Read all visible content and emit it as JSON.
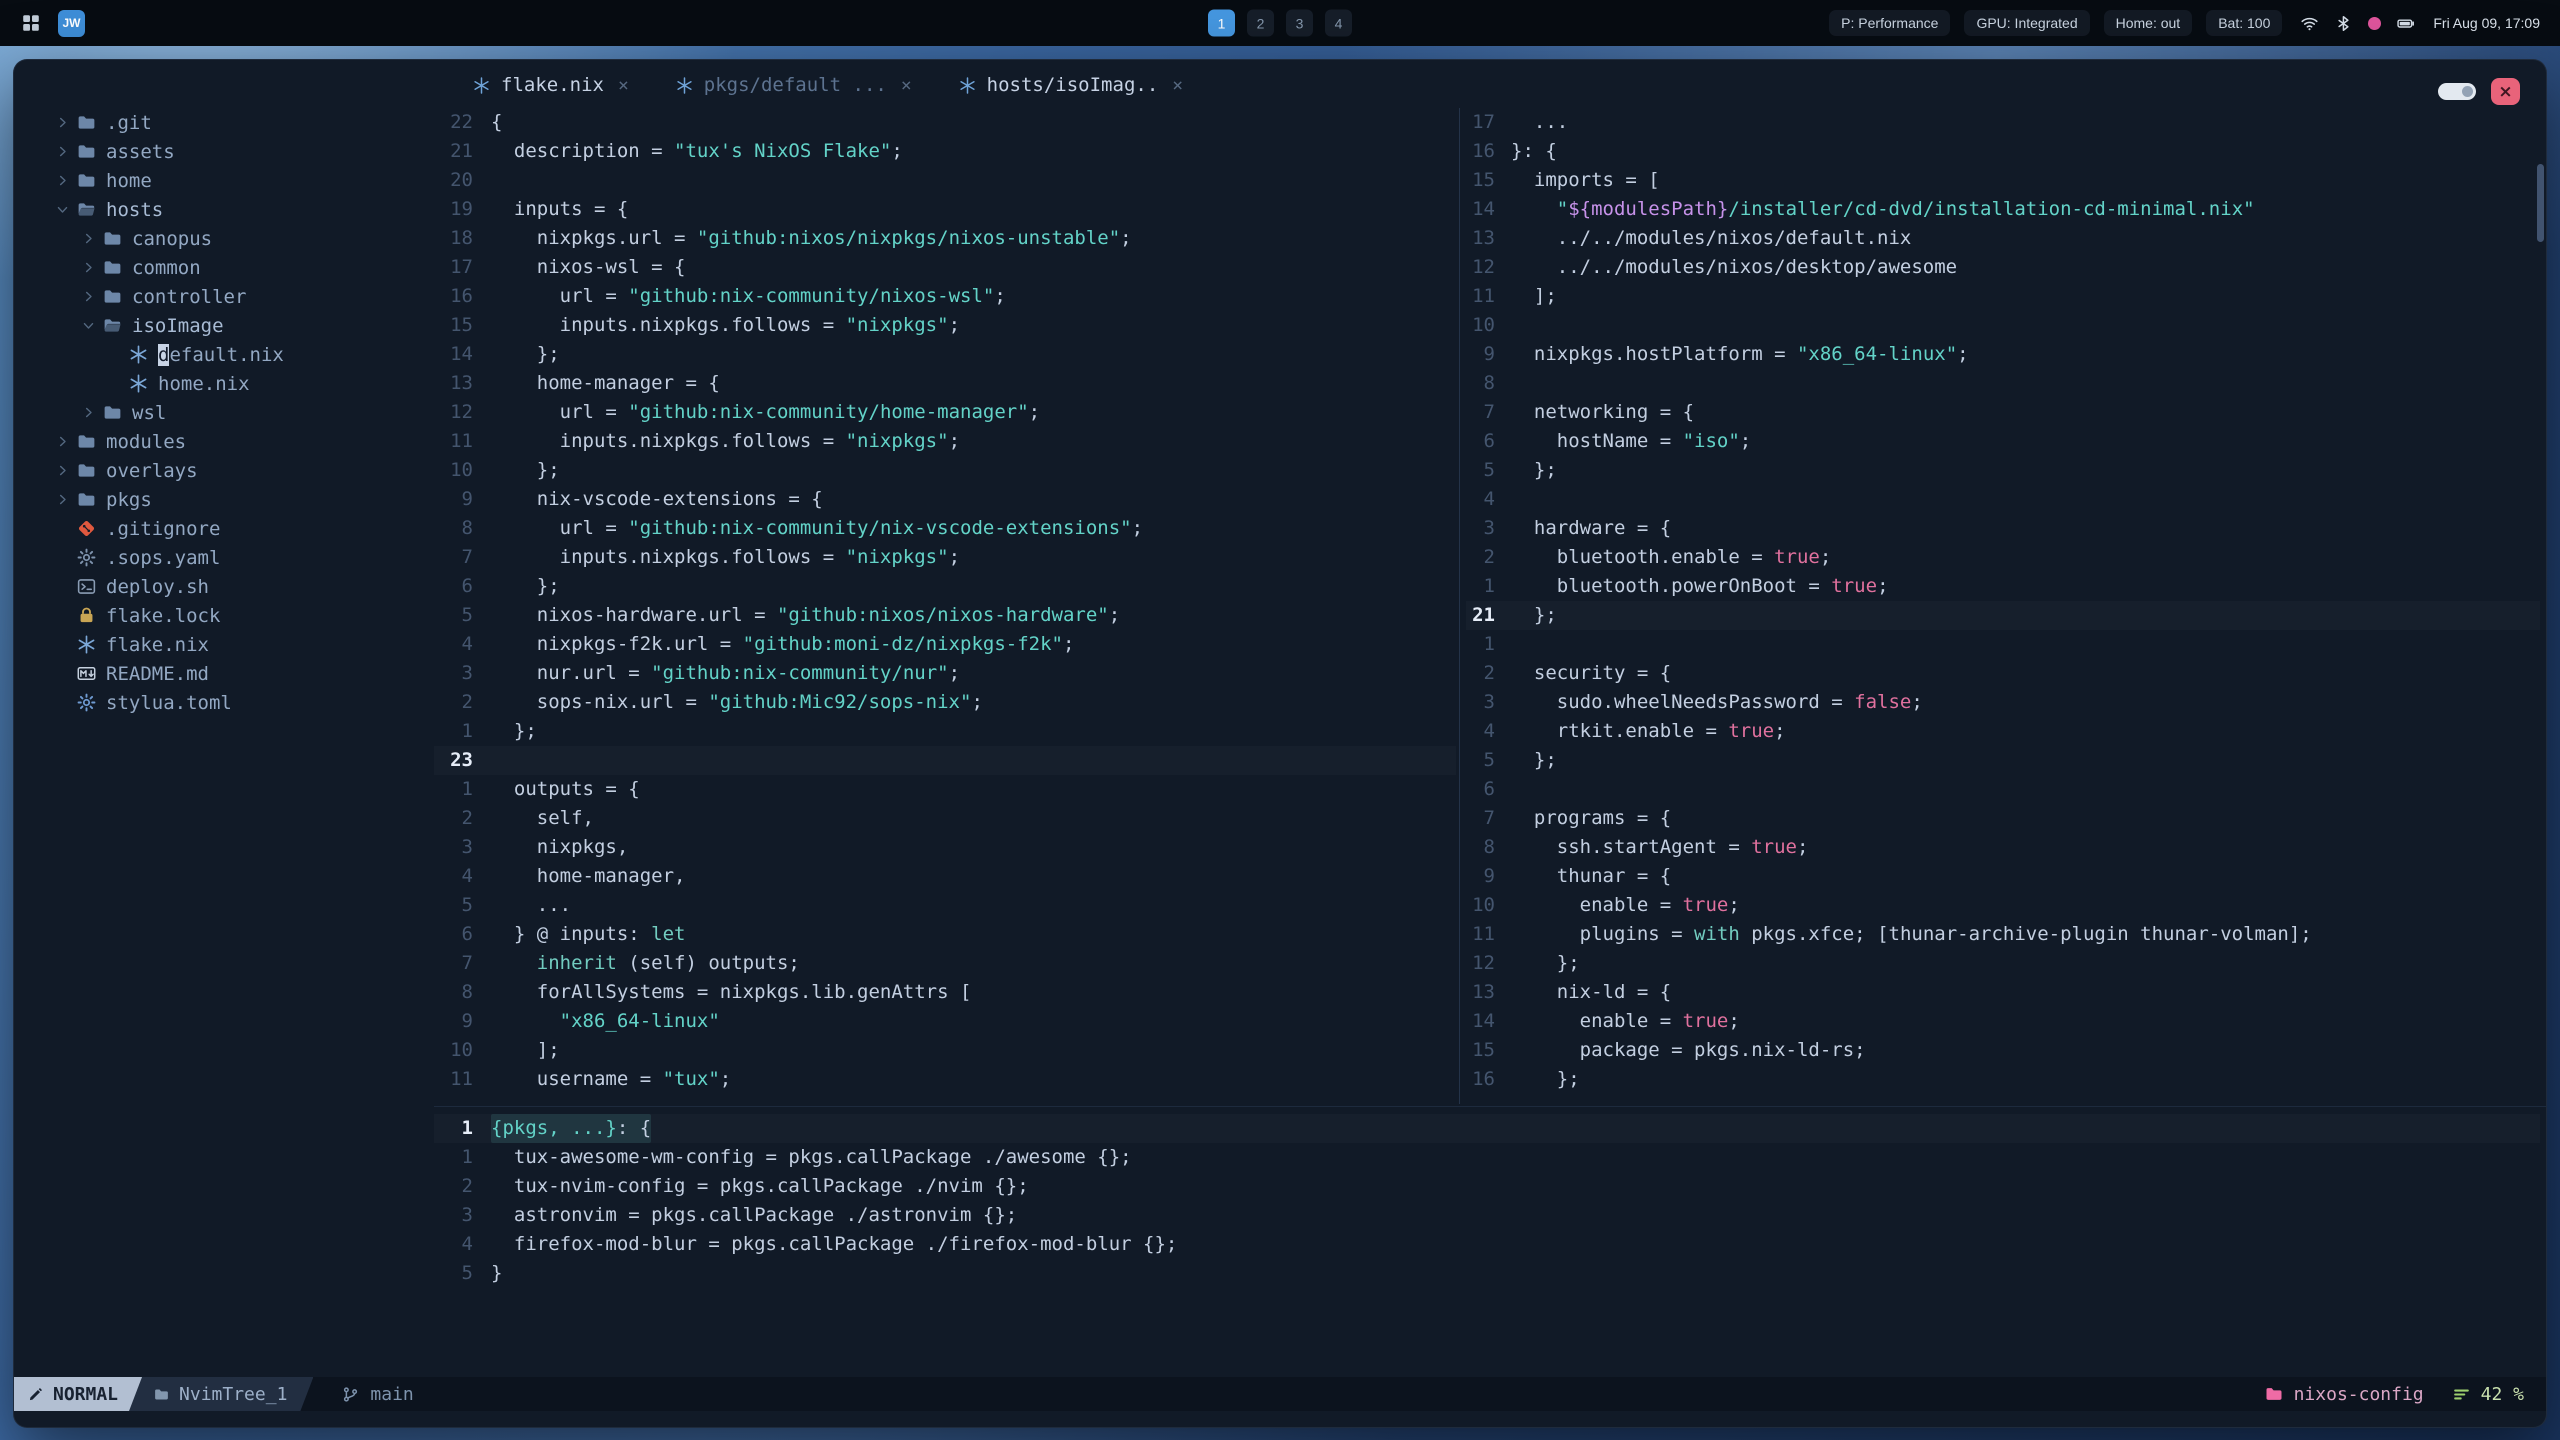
{
  "topbar": {
    "wm_label": "JW",
    "workspaces": [
      "1",
      "2",
      "3",
      "4"
    ],
    "active_workspace": "1",
    "modules": [
      "P: Performance",
      "GPU: Integrated",
      "Home: out",
      "Bat: 100"
    ],
    "clock": "Fri Aug 09, 17:09"
  },
  "window": {
    "tabs": [
      {
        "label": "flake.nix",
        "icon": "nix",
        "visible": true
      },
      {
        "label": "pkgs/default ...",
        "icon": "nix",
        "visible": false
      },
      {
        "label": "hosts/isoImag..",
        "icon": "nix",
        "visible": true
      }
    ],
    "close_label": "×"
  },
  "tree": {
    "items": [
      {
        "indent": 0,
        "chevron": "right",
        "icon": "folder",
        "label": ".git"
      },
      {
        "indent": 0,
        "chevron": "right",
        "icon": "folder",
        "label": "assets"
      },
      {
        "indent": 0,
        "chevron": "right",
        "icon": "folder",
        "label": "home"
      },
      {
        "indent": 0,
        "chevron": "down",
        "icon": "folder-open",
        "label": "hosts",
        "open": true
      },
      {
        "indent": 1,
        "chevron": "right",
        "icon": "folder",
        "label": "canopus"
      },
      {
        "indent": 1,
        "chevron": "right",
        "icon": "folder",
        "label": "common"
      },
      {
        "indent": 1,
        "chevron": "right",
        "icon": "folder",
        "label": "controller"
      },
      {
        "indent": 1,
        "chevron": "down",
        "icon": "folder-open",
        "label": "isoImage",
        "open": true
      },
      {
        "indent": 2,
        "icon": "nix",
        "label": "default.nix",
        "cursor": true
      },
      {
        "indent": 2,
        "icon": "nix",
        "label": "home.nix"
      },
      {
        "indent": 1,
        "chevron": "right",
        "icon": "folder",
        "label": "wsl"
      },
      {
        "indent": 0,
        "chevron": "right",
        "icon": "folder",
        "label": "modules"
      },
      {
        "indent": 0,
        "chevron": "right",
        "icon": "folder",
        "label": "overlays"
      },
      {
        "indent": 0,
        "chevron": "right",
        "icon": "folder",
        "label": "pkgs"
      },
      {
        "indent": 0,
        "icon": "git",
        "label": ".gitignore"
      },
      {
        "indent": 0,
        "icon": "gear",
        "label": ".sops.yaml"
      },
      {
        "indent": 0,
        "icon": "terminal",
        "label": "deploy.sh"
      },
      {
        "indent": 0,
        "icon": "lock",
        "label": "flake.lock"
      },
      {
        "indent": 0,
        "icon": "nix",
        "label": "flake.nix"
      },
      {
        "indent": 0,
        "icon": "markdown",
        "label": "README.md"
      },
      {
        "indent": 0,
        "icon": "gear-blue",
        "label": "stylua.toml"
      }
    ]
  },
  "editors": {
    "flake": [
      {
        "n": "22",
        "t": "{"
      },
      {
        "n": "21",
        "t": "  description = \"tux's NixOS Flake\";"
      },
      {
        "n": "20",
        "t": ""
      },
      {
        "n": "19",
        "t": "  inputs = {"
      },
      {
        "n": "18",
        "t": "    nixpkgs.url = \"github:nixos/nixpkgs/nixos-unstable\";"
      },
      {
        "n": "17",
        "t": "    nixos-wsl = {"
      },
      {
        "n": "16",
        "t": "      url = \"github:nix-community/nixos-wsl\";"
      },
      {
        "n": "15",
        "t": "      inputs.nixpkgs.follows = \"nixpkgs\";"
      },
      {
        "n": "14",
        "t": "    };"
      },
      {
        "n": "13",
        "t": "    home-manager = {"
      },
      {
        "n": "12",
        "t": "      url = \"github:nix-community/home-manager\";"
      },
      {
        "n": "11",
        "t": "      inputs.nixpkgs.follows = \"nixpkgs\";"
      },
      {
        "n": "10",
        "t": "    };"
      },
      {
        "n": "9",
        "t": "    nix-vscode-extensions = {"
      },
      {
        "n": "8",
        "t": "      url = \"github:nix-community/nix-vscode-extensions\";"
      },
      {
        "n": "7",
        "t": "      inputs.nixpkgs.follows = \"nixpkgs\";"
      },
      {
        "n": "6",
        "t": "    };"
      },
      {
        "n": "5",
        "t": "    nixos-hardware.url = \"github:nixos/nixos-hardware\";"
      },
      {
        "n": "4",
        "t": "    nixpkgs-f2k.url = \"github:moni-dz/nixpkgs-f2k\";"
      },
      {
        "n": "3",
        "t": "    nur.url = \"github:nix-community/nur\";"
      },
      {
        "n": "2",
        "t": "    sops-nix.url = \"github:Mic92/sops-nix\";"
      },
      {
        "n": "1",
        "t": "  };"
      },
      {
        "n": "23",
        "t": "",
        "cur": true
      },
      {
        "n": "1",
        "t": "  outputs = {"
      },
      {
        "n": "2",
        "t": "    self,"
      },
      {
        "n": "3",
        "t": "    nixpkgs,"
      },
      {
        "n": "4",
        "t": "    home-manager,"
      },
      {
        "n": "5",
        "t": "    ..."
      },
      {
        "n": "6",
        "t": "  } @ inputs: let"
      },
      {
        "n": "7",
        "t": "    inherit (self) outputs;"
      },
      {
        "n": "8",
        "t": "    forAllSystems = nixpkgs.lib.genAttrs ["
      },
      {
        "n": "9",
        "t": "      \"x86_64-linux\""
      },
      {
        "n": "10",
        "t": "    ];"
      },
      {
        "n": "11",
        "t": "    username = \"tux\";"
      }
    ],
    "iso": [
      {
        "n": "17",
        "t": "  ..."
      },
      {
        "n": "16",
        "t": "}: {"
      },
      {
        "n": "15",
        "t": "  imports = ["
      },
      {
        "n": "14",
        "t": "    \"${modulesPath}/installer/cd-dvd/installation-cd-minimal.nix\""
      },
      {
        "n": "13",
        "t": "    ../../modules/nixos/default.nix"
      },
      {
        "n": "12",
        "t": "    ../../modules/nixos/desktop/awesome"
      },
      {
        "n": "11",
        "t": "  ];"
      },
      {
        "n": "10",
        "t": ""
      },
      {
        "n": "9",
        "t": "  nixpkgs.hostPlatform = \"x86_64-linux\";"
      },
      {
        "n": "8",
        "t": ""
      },
      {
        "n": "7",
        "t": "  networking = {"
      },
      {
        "n": "6",
        "t": "    hostName = \"iso\";"
      },
      {
        "n": "5",
        "t": "  };"
      },
      {
        "n": "4",
        "t": ""
      },
      {
        "n": "3",
        "t": "  hardware = {"
      },
      {
        "n": "2",
        "t": "    bluetooth.enable = true;"
      },
      {
        "n": "1",
        "t": "    bluetooth.powerOnBoot = true;"
      },
      {
        "n": "21",
        "t": "  };",
        "cur": true
      },
      {
        "n": "1",
        "t": ""
      },
      {
        "n": "2",
        "t": "  security = {"
      },
      {
        "n": "3",
        "t": "    sudo.wheelNeedsPassword = false;"
      },
      {
        "n": "4",
        "t": "    rtkit.enable = true;"
      },
      {
        "n": "5",
        "t": "  };"
      },
      {
        "n": "6",
        "t": ""
      },
      {
        "n": "7",
        "t": "  programs = {"
      },
      {
        "n": "8",
        "t": "    ssh.startAgent = true;"
      },
      {
        "n": "9",
        "t": "    thunar = {"
      },
      {
        "n": "10",
        "t": "      enable = true;"
      },
      {
        "n": "11",
        "t": "      plugins = with pkgs.xfce; [thunar-archive-plugin thunar-volman];"
      },
      {
        "n": "12",
        "t": "    };"
      },
      {
        "n": "13",
        "t": "    nix-ld = {"
      },
      {
        "n": "14",
        "t": "      enable = true;"
      },
      {
        "n": "15",
        "t": "      package = pkgs.nix-ld-rs;"
      },
      {
        "n": "16",
        "t": "    };"
      }
    ],
    "pkgs": [
      {
        "n": "1",
        "cur": true,
        "sel": true,
        "seg": [
          {
            "t": "{pkgs, ...}",
            "c": "str"
          },
          {
            "t": ": {"
          }
        ]
      },
      {
        "n": "1",
        "t": "  tux-awesome-wm-config = pkgs.callPackage ./awesome {};"
      },
      {
        "n": "2",
        "t": "  tux-nvim-config = pkgs.callPackage ./nvim {};"
      },
      {
        "n": "3",
        "t": "  astronvim = pkgs.callPackage ./astronvim {};"
      },
      {
        "n": "4",
        "t": "  firefox-mod-blur = pkgs.callPackage ./firefox-mod-blur {};"
      },
      {
        "n": "5",
        "t": "}"
      }
    ]
  },
  "statusline": {
    "mode": "NORMAL",
    "buffer": "NvimTree_1",
    "branch": "main",
    "project": "nixos-config",
    "progress": "42 %"
  },
  "colors": {
    "accent_blue": "#4597e0",
    "string_teal": "#63d3c8",
    "bool_pink": "#e0719e",
    "close_red": "#e8637a",
    "project_pink": "#ef6ba5",
    "progress_green": "#9ed06f",
    "notification_pink": "#e0559d"
  }
}
